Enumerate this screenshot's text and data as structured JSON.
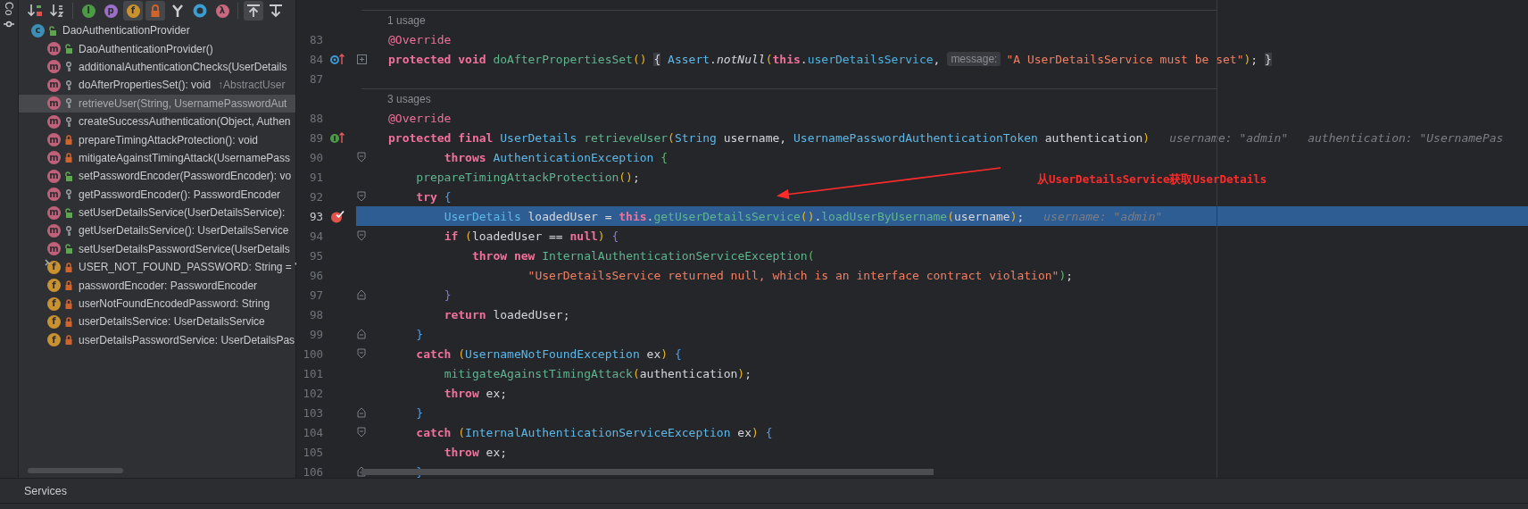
{
  "side_tab": {
    "label": "Co"
  },
  "structure": {
    "toolbar": [
      {
        "kind": "sort_visibility",
        "pressed": false
      },
      {
        "kind": "sort_alpha",
        "pressed": false
      },
      {
        "kind": "inherited",
        "glyph": "I",
        "pressed": false
      },
      {
        "kind": "properties",
        "glyph": "p",
        "pressed": false
      },
      {
        "kind": "fields",
        "glyph": "f",
        "pressed": true
      },
      {
        "kind": "non_public",
        "pressed": true
      },
      {
        "kind": "anonymous",
        "pressed": false
      },
      {
        "kind": "ring",
        "pressed": false
      },
      {
        "kind": "lambdas",
        "glyph": "λ",
        "pressed": false
      },
      {
        "kind": "autoscroll_to",
        "pressed": true
      },
      {
        "kind": "autoscroll_from",
        "pressed": false
      }
    ],
    "tree": {
      "kind": "class",
      "glyph": "c",
      "access": {
        "kind": "public"
      },
      "text": "DaoAuthenticationProvider",
      "selected": false,
      "children": [
        {
          "kind": "method",
          "glyph": "m",
          "access": {
            "kind": "public"
          },
          "text": "DaoAuthenticationProvider()",
          "selected": false,
          "static": false
        },
        {
          "kind": "method",
          "glyph": "m",
          "access": {
            "kind": "protected"
          },
          "text": "additionalAuthenticationChecks(UserDetails",
          "selected": false,
          "static": false
        },
        {
          "kind": "method",
          "glyph": "m",
          "access": {
            "kind": "protected"
          },
          "text": "doAfterPropertiesSet(): void",
          "suffix": "↑AbstractUser",
          "selected": false,
          "static": false
        },
        {
          "kind": "method",
          "glyph": "m",
          "access": {
            "kind": "protected"
          },
          "text": "retrieveUser(String, UsernamePasswordAut",
          "selected": true,
          "static": false
        },
        {
          "kind": "method",
          "glyph": "m",
          "access": {
            "kind": "protected"
          },
          "text": "createSuccessAuthentication(Object, Authen",
          "selected": false,
          "static": false
        },
        {
          "kind": "method",
          "glyph": "m",
          "access": {
            "kind": "private"
          },
          "text": "prepareTimingAttackProtection(): void",
          "selected": false,
          "static": false
        },
        {
          "kind": "method",
          "glyph": "m",
          "access": {
            "kind": "private"
          },
          "text": "mitigateAgainstTimingAttack(UsernamePass",
          "selected": false,
          "static": false
        },
        {
          "kind": "method",
          "glyph": "m",
          "access": {
            "kind": "public"
          },
          "text": "setPasswordEncoder(PasswordEncoder): vo",
          "selected": false,
          "static": false
        },
        {
          "kind": "method",
          "glyph": "m",
          "access": {
            "kind": "protected"
          },
          "text": "getPasswordEncoder(): PasswordEncoder",
          "selected": false,
          "static": false
        },
        {
          "kind": "method",
          "glyph": "m",
          "access": {
            "kind": "public"
          },
          "text": "setUserDetailsService(UserDetailsService):",
          "selected": false,
          "static": false
        },
        {
          "kind": "method",
          "glyph": "m",
          "access": {
            "kind": "protected"
          },
          "text": "getUserDetailsService(): UserDetailsService",
          "selected": false,
          "static": false
        },
        {
          "kind": "method",
          "glyph": "m",
          "access": {
            "kind": "public"
          },
          "text": "setUserDetailsPasswordService(UserDetails",
          "selected": false,
          "static": false
        },
        {
          "kind": "field",
          "glyph": "f",
          "access": {
            "kind": "private"
          },
          "text": "USER_NOT_FOUND_PASSWORD: String = \"",
          "selected": false,
          "static": true
        },
        {
          "kind": "field",
          "glyph": "f",
          "access": {
            "kind": "private"
          },
          "text": "passwordEncoder: PasswordEncoder",
          "selected": false,
          "static": false
        },
        {
          "kind": "field",
          "glyph": "f",
          "access": {
            "kind": "private"
          },
          "text": "userNotFoundEncodedPassword: String",
          "selected": false,
          "static": false
        },
        {
          "kind": "field",
          "glyph": "f",
          "access": {
            "kind": "private"
          },
          "text": "userDetailsService: UserDetailsService",
          "selected": false,
          "static": false
        },
        {
          "kind": "field",
          "glyph": "f",
          "access": {
            "kind": "private"
          },
          "text": "userDetailsPasswordService: UserDetailsPas",
          "selected": false,
          "static": false
        }
      ]
    }
  },
  "editor": {
    "lines": [
      {
        "kind": "usage",
        "text": "1 usage"
      },
      {
        "kind": "code",
        "number": "83",
        "highlighted": false,
        "tokens": [
          {
            "kind": "annotation",
            "text": "@Override"
          }
        ]
      },
      {
        "kind": "code",
        "number": "84",
        "highlighted": false,
        "gutter": {
          "kind": "overrides"
        },
        "fold": {
          "kind": "collapsed"
        },
        "tokens": [
          {
            "kind": "keyword",
            "text": "protected void "
          },
          {
            "kind": "method",
            "text": "doAfterPropertiesSet"
          },
          {
            "kind": "bracket_1",
            "text": "() "
          },
          {
            "kind": "folded_brace",
            "text": "{"
          },
          {
            "kind": "type",
            "text": " Assert"
          },
          {
            "kind": "plain",
            "text": "."
          },
          {
            "kind": "static_call",
            "text": "notNull"
          },
          {
            "kind": "bracket_1",
            "text": "("
          },
          {
            "kind": "keyword",
            "text": "this"
          },
          {
            "kind": "plain",
            "text": "."
          },
          {
            "kind": "field",
            "text": "userDetailsService"
          },
          {
            "kind": "plain",
            "text": ","
          },
          {
            "kind": "param_hint",
            "text": "message:"
          },
          {
            "kind": "string",
            "text": "\"A UserDetailsService must be set\""
          },
          {
            "kind": "bracket_1",
            "text": ")"
          },
          {
            "kind": "plain",
            "text": "; "
          },
          {
            "kind": "folded_brace",
            "text": "}"
          }
        ]
      },
      {
        "kind": "code",
        "number": "87",
        "highlighted": false
      },
      {
        "kind": "usage",
        "text": "3 usages"
      },
      {
        "kind": "code",
        "number": "88",
        "highlighted": false,
        "tokens": [
          {
            "kind": "annotation",
            "text": "@Override"
          }
        ]
      },
      {
        "kind": "code",
        "number": "89",
        "highlighted": false,
        "gutter": {
          "kind": "implements"
        },
        "tokens": [
          {
            "kind": "keyword",
            "text": "protected final "
          },
          {
            "kind": "type",
            "text": "UserDetails "
          },
          {
            "kind": "method",
            "text": "retrieveUser"
          },
          {
            "kind": "bracket_1",
            "text": "("
          },
          {
            "kind": "type",
            "text": "String "
          },
          {
            "kind": "plain",
            "text": "username, "
          },
          {
            "kind": "type",
            "text": "UsernamePasswordAuthenticationToken "
          },
          {
            "kind": "plain",
            "text": "authentication"
          },
          {
            "kind": "bracket_1",
            "text": ")"
          },
          {
            "kind": "hint",
            "text": "username: \"admin\""
          },
          {
            "kind": "hint",
            "text": "authentication: \"UsernamePas"
          }
        ]
      },
      {
        "kind": "code",
        "number": "90",
        "highlighted": false,
        "indent": {
          "kind": "two"
        },
        "fold": {
          "kind": "start"
        },
        "tokens": [
          {
            "kind": "keyword",
            "text": "throws "
          },
          {
            "kind": "type",
            "text": "AuthenticationException "
          },
          {
            "kind": "bracket_3",
            "text": "{"
          }
        ]
      },
      {
        "kind": "code",
        "number": "91",
        "highlighted": false,
        "indent": {
          "kind": "one"
        },
        "tokens": [
          {
            "kind": "method",
            "text": "prepareTimingAttackProtection"
          },
          {
            "kind": "bracket_1",
            "text": "()"
          },
          {
            "kind": "plain",
            "text": ";"
          }
        ]
      },
      {
        "kind": "code",
        "number": "92",
        "highlighted": false,
        "indent": {
          "kind": "one"
        },
        "fold": {
          "kind": "start"
        },
        "tokens": [
          {
            "kind": "keyword",
            "text": "try "
          },
          {
            "kind": "bracket_2",
            "text": "{"
          }
        ]
      },
      {
        "kind": "code",
        "number": "93",
        "highlighted": true,
        "indent": {
          "kind": "two"
        },
        "gutter": {
          "kind": "breakpoint"
        },
        "tokens": [
          {
            "kind": "type",
            "text": "UserDetails "
          },
          {
            "kind": "plain",
            "text": "loadedUser = "
          },
          {
            "kind": "keyword",
            "text": "this"
          },
          {
            "kind": "plain",
            "text": "."
          },
          {
            "kind": "method",
            "text": "getUserDetailsService"
          },
          {
            "kind": "bracket_1",
            "text": "()"
          },
          {
            "kind": "plain",
            "text": "."
          },
          {
            "kind": "method",
            "text": "loadUserByUsername"
          },
          {
            "kind": "bracket_1",
            "text": "("
          },
          {
            "kind": "plain",
            "text": "username"
          },
          {
            "kind": "bracket_1",
            "text": ")"
          },
          {
            "kind": "plain",
            "text": ";"
          },
          {
            "kind": "hint",
            "text": "username: \"admin\""
          }
        ]
      },
      {
        "kind": "code",
        "number": "94",
        "highlighted": false,
        "indent": {
          "kind": "two"
        },
        "fold": {
          "kind": "start"
        },
        "tokens": [
          {
            "kind": "keyword",
            "text": "if "
          },
          {
            "kind": "bracket_1",
            "text": "("
          },
          {
            "kind": "plain",
            "text": "loadedUser == "
          },
          {
            "kind": "keyword",
            "text": "null"
          },
          {
            "kind": "bracket_1",
            "text": ") "
          },
          {
            "kind": "bracket_4",
            "text": "{"
          }
        ]
      },
      {
        "kind": "code",
        "number": "95",
        "highlighted": false,
        "indent": {
          "kind": "three"
        },
        "tokens": [
          {
            "kind": "keyword",
            "text": "throw new "
          },
          {
            "kind": "method",
            "text": "InternalAuthenticationServiceException"
          },
          {
            "kind": "bracket_3",
            "text": "("
          }
        ]
      },
      {
        "kind": "code",
        "number": "96",
        "highlighted": false,
        "indent": {
          "kind": "five"
        },
        "tokens": [
          {
            "kind": "string",
            "text": "\"UserDetailsService returned null, which is an interface contract violation\""
          },
          {
            "kind": "bracket_3",
            "text": ")"
          },
          {
            "kind": "plain",
            "text": ";"
          }
        ]
      },
      {
        "kind": "code",
        "number": "97",
        "highlighted": false,
        "indent": {
          "kind": "two"
        },
        "fold": {
          "kind": "end"
        },
        "tokens": [
          {
            "kind": "bracket_4",
            "text": "}"
          }
        ]
      },
      {
        "kind": "code",
        "number": "98",
        "highlighted": false,
        "indent": {
          "kind": "two"
        },
        "tokens": [
          {
            "kind": "keyword",
            "text": "return "
          },
          {
            "kind": "plain",
            "text": "loadedUser;"
          }
        ]
      },
      {
        "kind": "code",
        "number": "99",
        "highlighted": false,
        "indent": {
          "kind": "one"
        },
        "fold": {
          "kind": "end"
        },
        "tokens": [
          {
            "kind": "bracket_2",
            "text": "}"
          }
        ]
      },
      {
        "kind": "code",
        "number": "100",
        "highlighted": false,
        "indent": {
          "kind": "one"
        },
        "fold": {
          "kind": "start"
        },
        "tokens": [
          {
            "kind": "keyword",
            "text": "catch "
          },
          {
            "kind": "bracket_1",
            "text": "("
          },
          {
            "kind": "type",
            "text": "UsernameNotFoundException "
          },
          {
            "kind": "plain",
            "text": "ex"
          },
          {
            "kind": "bracket_1",
            "text": ") "
          },
          {
            "kind": "bracket_2",
            "text": "{"
          }
        ]
      },
      {
        "kind": "code",
        "number": "101",
        "highlighted": false,
        "indent": {
          "kind": "two"
        },
        "tokens": [
          {
            "kind": "method",
            "text": "mitigateAgainstTimingAttack"
          },
          {
            "kind": "bracket_1",
            "text": "("
          },
          {
            "kind": "plain",
            "text": "authentication"
          },
          {
            "kind": "bracket_1",
            "text": ")"
          },
          {
            "kind": "plain",
            "text": ";"
          }
        ]
      },
      {
        "kind": "code",
        "number": "102",
        "highlighted": false,
        "indent": {
          "kind": "two"
        },
        "tokens": [
          {
            "kind": "keyword",
            "text": "throw "
          },
          {
            "kind": "plain",
            "text": "ex;"
          }
        ]
      },
      {
        "kind": "code",
        "number": "103",
        "highlighted": false,
        "indent": {
          "kind": "one"
        },
        "fold": {
          "kind": "end"
        },
        "tokens": [
          {
            "kind": "bracket_2",
            "text": "}"
          }
        ]
      },
      {
        "kind": "code",
        "number": "104",
        "highlighted": false,
        "indent": {
          "kind": "one"
        },
        "fold": {
          "kind": "start"
        },
        "tokens": [
          {
            "kind": "keyword",
            "text": "catch "
          },
          {
            "kind": "bracket_1",
            "text": "("
          },
          {
            "kind": "type",
            "text": "InternalAuthenticationServiceException "
          },
          {
            "kind": "plain",
            "text": "ex"
          },
          {
            "kind": "bracket_1",
            "text": ") "
          },
          {
            "kind": "bracket_2",
            "text": "{"
          }
        ]
      },
      {
        "kind": "code",
        "number": "105",
        "highlighted": false,
        "indent": {
          "kind": "two"
        },
        "tokens": [
          {
            "kind": "keyword",
            "text": "throw "
          },
          {
            "kind": "plain",
            "text": "ex;"
          }
        ]
      },
      {
        "kind": "code",
        "number": "106",
        "highlighted": false,
        "indent": {
          "kind": "one"
        },
        "fold": {
          "kind": "end"
        },
        "tokens": [
          {
            "kind": "bracket_2",
            "text": "}"
          }
        ]
      }
    ],
    "annotation": {
      "text": "从UserDetailsService获取UserDetails"
    }
  },
  "bottom_panel": {
    "title": "Services"
  }
}
